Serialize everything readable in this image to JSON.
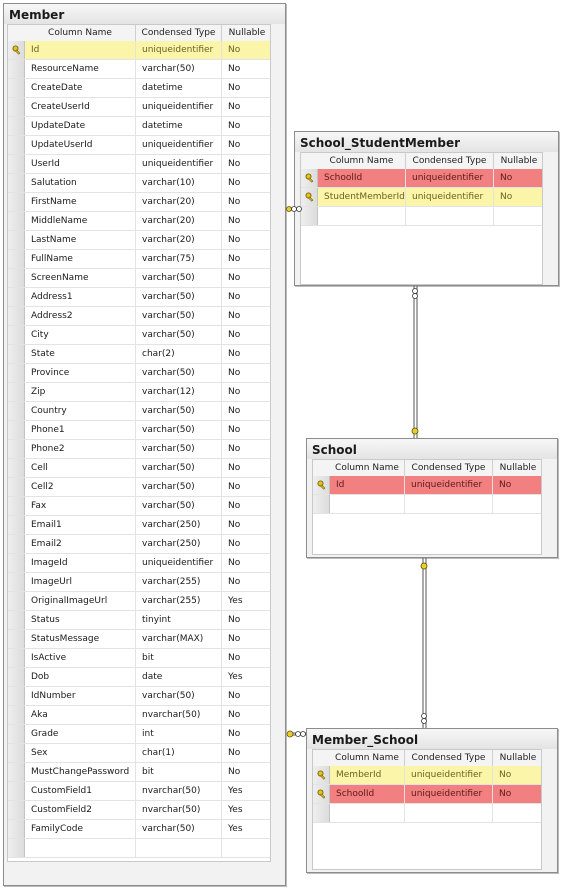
{
  "headers": {
    "col": "Column Name",
    "type": "Condensed Type",
    "null": "Nullable"
  },
  "colors": {
    "primary_key_row": "#faf5a8",
    "foreign_key_row": "#f28080",
    "connector": "#555555",
    "key_icon": "#d4b300"
  },
  "tables": {
    "member": {
      "title": "Member",
      "rows": [
        {
          "name": "Id",
          "type": "uniqueidentifier",
          "nullable": "No",
          "key": "pk"
        },
        {
          "name": "ResourceName",
          "type": "varchar(50)",
          "nullable": "No"
        },
        {
          "name": "CreateDate",
          "type": "datetime",
          "nullable": "No"
        },
        {
          "name": "CreateUserId",
          "type": "uniqueidentifier",
          "nullable": "No"
        },
        {
          "name": "UpdateDate",
          "type": "datetime",
          "nullable": "No"
        },
        {
          "name": "UpdateUserId",
          "type": "uniqueidentifier",
          "nullable": "No"
        },
        {
          "name": "UserId",
          "type": "uniqueidentifier",
          "nullable": "No"
        },
        {
          "name": "Salutation",
          "type": "varchar(10)",
          "nullable": "No"
        },
        {
          "name": "FirstName",
          "type": "varchar(20)",
          "nullable": "No"
        },
        {
          "name": "MiddleName",
          "type": "varchar(20)",
          "nullable": "No"
        },
        {
          "name": "LastName",
          "type": "varchar(20)",
          "nullable": "No"
        },
        {
          "name": "FullName",
          "type": "varchar(75)",
          "nullable": "No"
        },
        {
          "name": "ScreenName",
          "type": "varchar(50)",
          "nullable": "No"
        },
        {
          "name": "Address1",
          "type": "varchar(50)",
          "nullable": "No"
        },
        {
          "name": "Address2",
          "type": "varchar(50)",
          "nullable": "No"
        },
        {
          "name": "City",
          "type": "varchar(50)",
          "nullable": "No"
        },
        {
          "name": "State",
          "type": "char(2)",
          "nullable": "No"
        },
        {
          "name": "Province",
          "type": "varchar(50)",
          "nullable": "No"
        },
        {
          "name": "Zip",
          "type": "varchar(12)",
          "nullable": "No"
        },
        {
          "name": "Country",
          "type": "varchar(50)",
          "nullable": "No"
        },
        {
          "name": "Phone1",
          "type": "varchar(50)",
          "nullable": "No"
        },
        {
          "name": "Phone2",
          "type": "varchar(50)",
          "nullable": "No"
        },
        {
          "name": "Cell",
          "type": "varchar(50)",
          "nullable": "No"
        },
        {
          "name": "Cell2",
          "type": "varchar(50)",
          "nullable": "No"
        },
        {
          "name": "Fax",
          "type": "varchar(50)",
          "nullable": "No"
        },
        {
          "name": "Email1",
          "type": "varchar(250)",
          "nullable": "No"
        },
        {
          "name": "Email2",
          "type": "varchar(250)",
          "nullable": "No"
        },
        {
          "name": "ImageId",
          "type": "uniqueidentifier",
          "nullable": "No"
        },
        {
          "name": "ImageUrl",
          "type": "varchar(255)",
          "nullable": "No"
        },
        {
          "name": "OriginalImageUrl",
          "type": "varchar(255)",
          "nullable": "Yes"
        },
        {
          "name": "Status",
          "type": "tinyint",
          "nullable": "No"
        },
        {
          "name": "StatusMessage",
          "type": "varchar(MAX)",
          "nullable": "No"
        },
        {
          "name": "IsActive",
          "type": "bit",
          "nullable": "No"
        },
        {
          "name": "Dob",
          "type": "date",
          "nullable": "Yes"
        },
        {
          "name": "IdNumber",
          "type": "varchar(50)",
          "nullable": "No"
        },
        {
          "name": "Aka",
          "type": "nvarchar(50)",
          "nullable": "No"
        },
        {
          "name": "Grade",
          "type": "int",
          "nullable": "No"
        },
        {
          "name": "Sex",
          "type": "char(1)",
          "nullable": "No"
        },
        {
          "name": "MustChangePassword",
          "type": "bit",
          "nullable": "No"
        },
        {
          "name": "CustomField1",
          "type": "nvarchar(50)",
          "nullable": "Yes"
        },
        {
          "name": "CustomField2",
          "type": "nvarchar(50)",
          "nullable": "Yes"
        },
        {
          "name": "FamilyCode",
          "type": "varchar(50)",
          "nullable": "Yes"
        },
        {
          "name": "",
          "type": "",
          "nullable": ""
        }
      ]
    },
    "school_student_member": {
      "title": "School_StudentMember",
      "rows": [
        {
          "name": "SchoolId",
          "type": "uniqueidentifier",
          "nullable": "No",
          "key": "fk"
        },
        {
          "name": "StudentMemberId",
          "type": "uniqueidentifier",
          "nullable": "No",
          "key": "pk"
        },
        {
          "name": "",
          "type": "",
          "nullable": ""
        }
      ]
    },
    "school": {
      "title": "School",
      "rows": [
        {
          "name": "Id",
          "type": "uniqueidentifier",
          "nullable": "No",
          "key": "fk"
        },
        {
          "name": "",
          "type": "",
          "nullable": ""
        }
      ]
    },
    "member_school": {
      "title": "Member_School",
      "rows": [
        {
          "name": "MemberId",
          "type": "uniqueidentifier",
          "nullable": "No",
          "key": "pk"
        },
        {
          "name": "SchoolId",
          "type": "uniqueidentifier",
          "nullable": "No",
          "key": "fk"
        },
        {
          "name": "",
          "type": "",
          "nullable": ""
        }
      ]
    }
  }
}
